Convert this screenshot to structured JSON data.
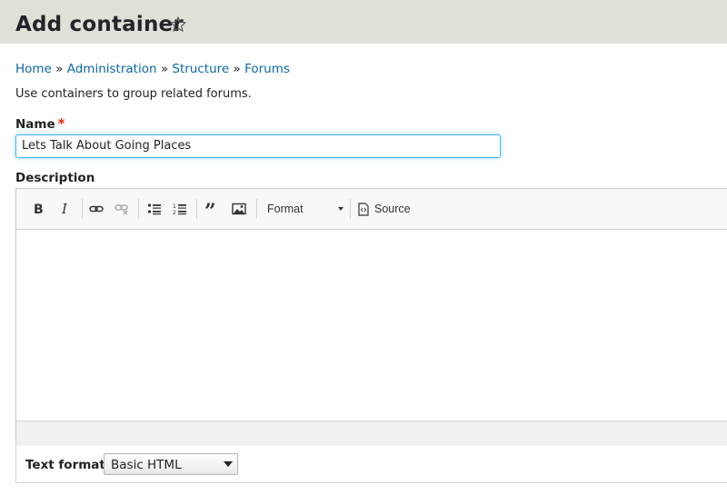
{
  "header": {
    "title": "Add container",
    "favorite_icon": "star-outline-icon"
  },
  "breadcrumb": {
    "items": [
      "Home",
      "Administration",
      "Structure",
      "Forums"
    ],
    "separator": "»"
  },
  "intro_text": "Use containers to group related forums.",
  "name_field": {
    "label": "Name",
    "required_mark": "*",
    "value": "Lets Talk About Going Places"
  },
  "description_field": {
    "label": "Description",
    "toolbar": {
      "bold_icon": "bold-icon",
      "italic_icon": "italic-icon",
      "link_icon": "link-icon",
      "unlink_icon": "unlink-icon",
      "bulleted_list_icon": "bulleted-list-icon",
      "numbered_list_icon": "numbered-list-icon",
      "blockquote_icon": "blockquote-icon",
      "image_icon": "image-icon",
      "format_label": "Format",
      "source_label": "Source"
    }
  },
  "text_format": {
    "label": "Text format",
    "selected": "Basic HTML"
  },
  "colors": {
    "header_bg": "#e0dfd8",
    "link": "#0b68a8",
    "required": "#e62600",
    "focus_border": "#40b6ff"
  }
}
